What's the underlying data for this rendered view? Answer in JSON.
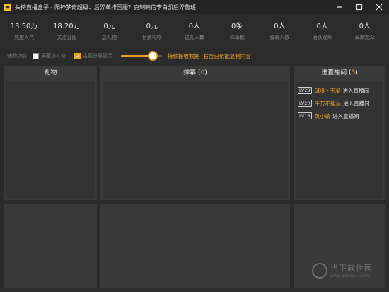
{
  "window": {
    "title": "头榜直播盒子 - 阳神梦奇超级：后羿单排国服？克制韩信李白凯后羿鲁班"
  },
  "stats": [
    {
      "value": "13.50万",
      "label": "热度人气"
    },
    {
      "value": "18.20万",
      "label": "关注订阅"
    },
    {
      "value": "0元",
      "label": "总礼物"
    },
    {
      "value": "0元",
      "label": "付费礼物"
    },
    {
      "value": "0人",
      "label": "送礼人数"
    },
    {
      "value": "0条",
      "label": "弹幕数"
    },
    {
      "value": "0人",
      "label": "弹幕人数"
    },
    {
      "value": "0人",
      "label": "活跃观众"
    },
    {
      "value": "0人",
      "label": "离席观众"
    }
  ],
  "options": {
    "assist_label": "辅助功能",
    "block_gift_label": "屏蔽小礼物",
    "block_gift_checked": false,
    "main_split_label": "主要分屏显示",
    "main_split_checked": true,
    "slider_value": 0.78,
    "slider_text": "持续接收数据 (右击记录能复制内容)"
  },
  "panels": {
    "gift_title": "礼物",
    "danmu_title": "弹幕",
    "danmu_count": "0",
    "enter_title": "进直播间",
    "enter_count": "3"
  },
  "enter_list": [
    {
      "level": "LV28",
      "name": "688丶韦凝",
      "action": "进入直播间"
    },
    {
      "level": "LV20",
      "name": "千万不能怂",
      "action": "进入直播间"
    },
    {
      "level": "LV18",
      "name": "黄小婧",
      "action": "进入直播间"
    }
  ],
  "watermark": {
    "main": "当下软件园",
    "sub": "www.downxia.com"
  },
  "colors": {
    "accent": "#f0a020",
    "background": "#2b2b2b",
    "panel": "#3a3a3a"
  }
}
